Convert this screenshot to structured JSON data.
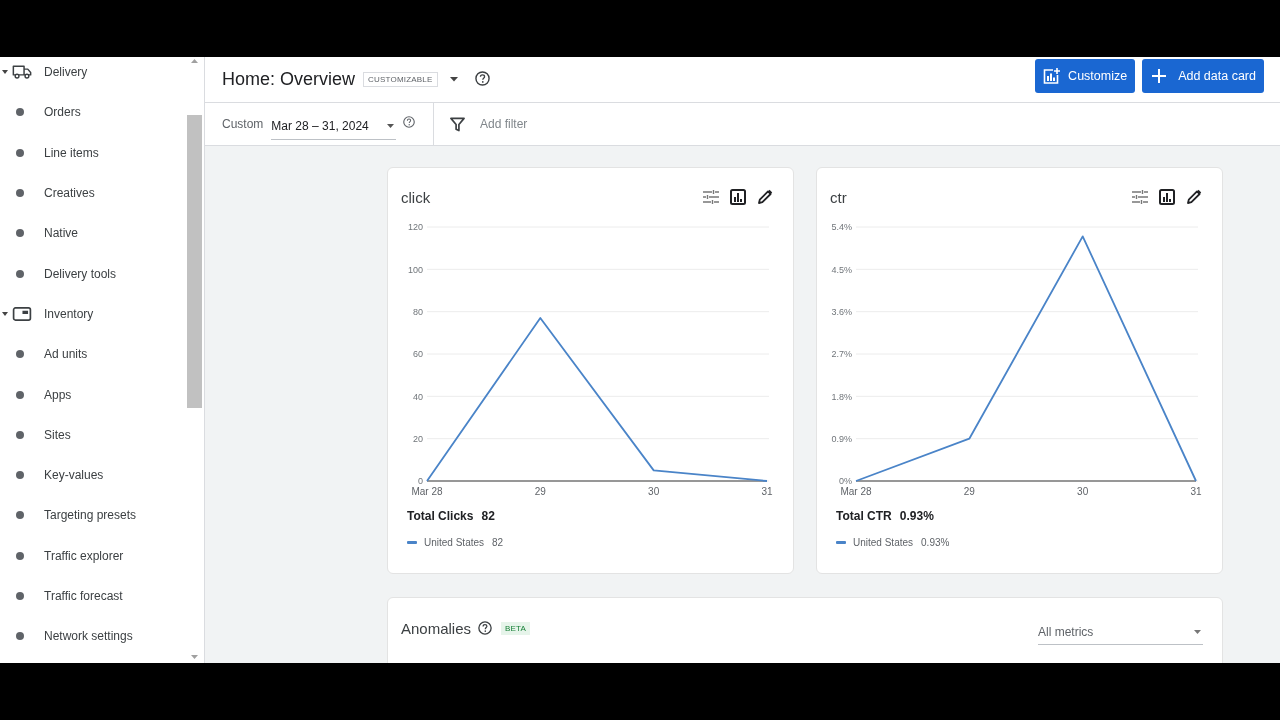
{
  "sidebar": {
    "items": [
      {
        "label": "Delivery",
        "expanded": true,
        "selected": false,
        "children": [
          {
            "label": "Orders",
            "selected": false
          },
          {
            "label": "Line items",
            "selected": false
          },
          {
            "label": "Creatives",
            "selected": false
          },
          {
            "label": "Native",
            "selected": false
          },
          {
            "label": "Delivery tools",
            "selected": false
          }
        ]
      },
      {
        "label": "Inventory",
        "expanded": true,
        "selected": false,
        "children": [
          {
            "label": "Ad units",
            "selected": false
          },
          {
            "label": "Apps",
            "selected": false
          },
          {
            "label": "Sites",
            "selected": false
          },
          {
            "label": "Key-values",
            "selected": false
          },
          {
            "label": "Targeting presets",
            "selected": false
          },
          {
            "label": "Traffic explorer",
            "selected": false
          },
          {
            "label": "Traffic forecast",
            "selected": false
          },
          {
            "label": "Network settings",
            "selected": false
          }
        ]
      }
    ]
  },
  "header": {
    "title": "Home: Overview",
    "badge": "CUSTOMIZABLE",
    "buttons": [
      {
        "label": "Customize"
      },
      {
        "label": "Add data card"
      }
    ]
  },
  "filter_bar": {
    "date_label": "Custom",
    "date_range": "Mar 28 – 31, 2024",
    "filter_placeholder": "Add filter"
  },
  "cards": [
    {
      "title": "click",
      "total_label": "Total Clicks",
      "total_value": "82",
      "legend_value": "82",
      "chart_data": {
        "type": "line",
        "categories": [
          "Mar 28",
          "29",
          "30",
          "31"
        ],
        "ylim": [
          0,
          120
        ],
        "yticks": [
          0,
          20,
          40,
          60,
          80,
          100,
          120
        ],
        "grid": true,
        "series": [
          {
            "name": "United States",
            "color": "#4a84c8",
            "values": [
              0,
              77,
              5,
              0
            ]
          }
        ]
      }
    },
    {
      "title": "ctr",
      "total_label": "Total CTR",
      "total_value": "0.93%",
      "legend_value": "0.93%",
      "chart_data": {
        "type": "line",
        "categories": [
          "Mar 28",
          "29",
          "30",
          "31"
        ],
        "ylim": [
          0,
          5.4
        ],
        "yticks": [
          {
            "value": 0,
            "label": "0%"
          },
          {
            "value": 0.9,
            "label": "0.9%"
          },
          {
            "value": 1.8,
            "label": "1.8%"
          },
          {
            "value": 2.7,
            "label": "2.7%"
          },
          {
            "value": 3.6,
            "label": "3.6%"
          },
          {
            "value": 4.5,
            "label": "4.5%"
          },
          {
            "value": 5.4,
            "label": "5.4%"
          }
        ],
        "grid": true,
        "series": [
          {
            "name": "United States",
            "color": "#4a84c8",
            "values": [
              0,
              0.9,
              5.2,
              0
            ]
          }
        ]
      }
    }
  ],
  "anomalies": {
    "title": "Anomalies",
    "badge": "BETA",
    "dropdown": "All metrics"
  }
}
